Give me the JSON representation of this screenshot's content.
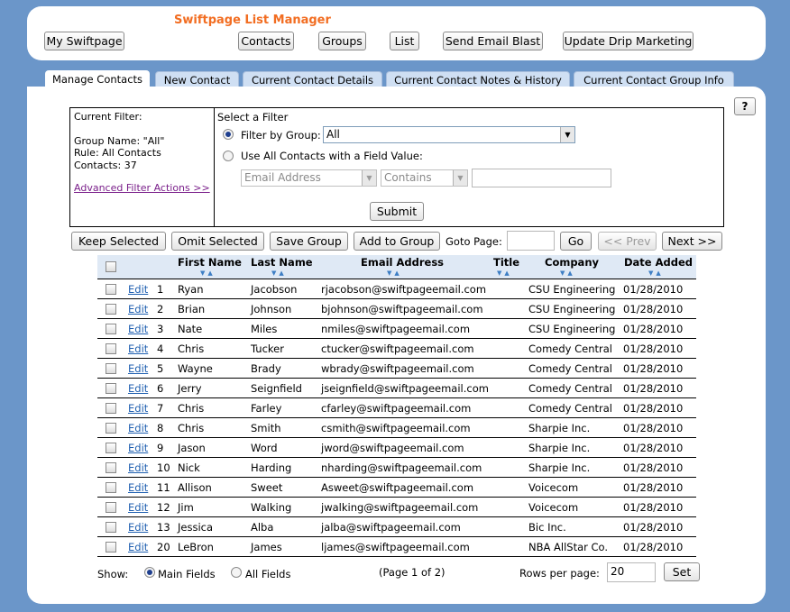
{
  "header": {
    "title": "Swiftpage List Manager",
    "nav": [
      "My Swiftpage",
      "Contacts",
      "Groups",
      "List",
      "Send Email Blast",
      "Update Drip Marketing"
    ]
  },
  "tabs": [
    "Manage Contacts",
    "New Contact",
    "Current Contact Details",
    "Current Contact Notes & History",
    "Current Contact Group Info"
  ],
  "help_label": "?",
  "filter": {
    "current_label": "Current Filter:",
    "group_name": "Group Name: \"All\"",
    "rule": "Rule: All Contacts",
    "contacts": "Contacts: 37",
    "advanced_link": "Advanced Filter Actions >>",
    "select_label": "Select a Filter",
    "by_group_label": "Filter by Group:",
    "group_value": "All",
    "field_value_label": "Use All Contacts with a Field Value:",
    "field_select": "Email Address",
    "operator_select": "Contains",
    "field_text": "",
    "submit_label": "Submit"
  },
  "actions": {
    "keep": "Keep Selected",
    "omit": "Omit Selected",
    "save_group": "Save Group",
    "add_group": "Add to Group",
    "goto_label": "Goto Page:",
    "goto_value": "",
    "go": "Go",
    "prev": "<< Prev",
    "next": "Next >>"
  },
  "table": {
    "columns": [
      "First Name",
      "Last Name",
      "Email Address",
      "Title",
      "Company",
      "Date Added"
    ],
    "edit_label": "Edit",
    "rows": [
      {
        "num": "1",
        "first": "Ryan",
        "last": "Jacobson",
        "email": "rjacobson@swiftpageemail.com",
        "title": "",
        "company": "CSU Engineering",
        "date": "01/28/2010"
      },
      {
        "num": "2",
        "first": "Brian",
        "last": "Johnson",
        "email": "bjohnson@swiftpageemail.com",
        "title": "",
        "company": "CSU Engineering",
        "date": "01/28/2010"
      },
      {
        "num": "3",
        "first": "Nate",
        "last": "Miles",
        "email": "nmiles@swiftpageemail.com",
        "title": "",
        "company": "CSU Engineering",
        "date": "01/28/2010"
      },
      {
        "num": "4",
        "first": "Chris",
        "last": "Tucker",
        "email": "ctucker@swiftpageemail.com",
        "title": "",
        "company": "Comedy Central",
        "date": "01/28/2010"
      },
      {
        "num": "5",
        "first": "Wayne",
        "last": "Brady",
        "email": "wbrady@swiftpageemail.com",
        "title": "",
        "company": "Comedy Central",
        "date": "01/28/2010"
      },
      {
        "num": "6",
        "first": "Jerry",
        "last": "Seignfield",
        "email": "jseignfield@swiftpageemail.com",
        "title": "",
        "company": "Comedy Central",
        "date": "01/28/2010"
      },
      {
        "num": "7",
        "first": "Chris",
        "last": "Farley",
        "email": "cfarley@swiftpageemail.com",
        "title": "",
        "company": "Comedy Central",
        "date": "01/28/2010"
      },
      {
        "num": "8",
        "first": "Chris",
        "last": "Smith",
        "email": "csmith@swiftpageemail.com",
        "title": "",
        "company": "Sharpie Inc.",
        "date": "01/28/2010"
      },
      {
        "num": "9",
        "first": "Jason",
        "last": "Word",
        "email": "jword@swiftpageemail.com",
        "title": "",
        "company": "Sharpie Inc.",
        "date": "01/28/2010"
      },
      {
        "num": "10",
        "first": "Nick",
        "last": "Harding",
        "email": "nharding@swiftpageemail.com",
        "title": "",
        "company": "Sharpie Inc.",
        "date": "01/28/2010"
      },
      {
        "num": "11",
        "first": "Allison",
        "last": "Sweet",
        "email": "Asweet@swiftpageemail.com",
        "title": "",
        "company": "Voicecom",
        "date": "01/28/2010"
      },
      {
        "num": "12",
        "first": "Jim",
        "last": "Walking",
        "email": "jwalking@swiftpageemail.com",
        "title": "",
        "company": "Voicecom",
        "date": "01/28/2010"
      },
      {
        "num": "13",
        "first": "Jessica",
        "last": "Alba",
        "email": "jalba@swiftpageemail.com",
        "title": "",
        "company": "Bic Inc.",
        "date": "01/28/2010"
      },
      {
        "num": "20",
        "first": "LeBron",
        "last": "James",
        "email": "ljames@swiftpageemail.com",
        "title": "",
        "company": "NBA AllStar Co.",
        "date": "01/28/2010"
      }
    ]
  },
  "footer": {
    "show_label": "Show:",
    "main_fields": "Main Fields",
    "all_fields": "All Fields",
    "page_info": "(Page 1 of 2)",
    "rows_label": "Rows per page:",
    "rows_value": "20",
    "set_label": "Set"
  },
  "colors": {
    "background": "#6b96c9",
    "title": "#f26d21",
    "tab": "#cfdff3",
    "link": "#1f5fb0",
    "visited_link": "#7a1f8a",
    "table_header": "#dfe9f5"
  },
  "icons": [
    "dropdown-arrow-icon",
    "sort-arrow-icon",
    "radio-icon",
    "checkbox-icon"
  ]
}
